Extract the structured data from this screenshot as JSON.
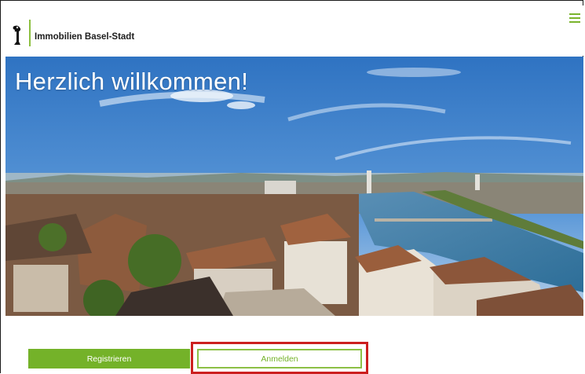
{
  "header": {
    "brand_name": "Immobilien Basel-Stadt",
    "logo_icon": "basel-staff-icon",
    "menu_icon": "hamburger-menu-icon"
  },
  "hero": {
    "title": "Herzlich willkommen!"
  },
  "actions": {
    "register_label": "Registrieren",
    "login_label": "Anmelden"
  },
  "colors": {
    "accent_green": "#74b229",
    "highlight_red": "#cc1f1f"
  }
}
